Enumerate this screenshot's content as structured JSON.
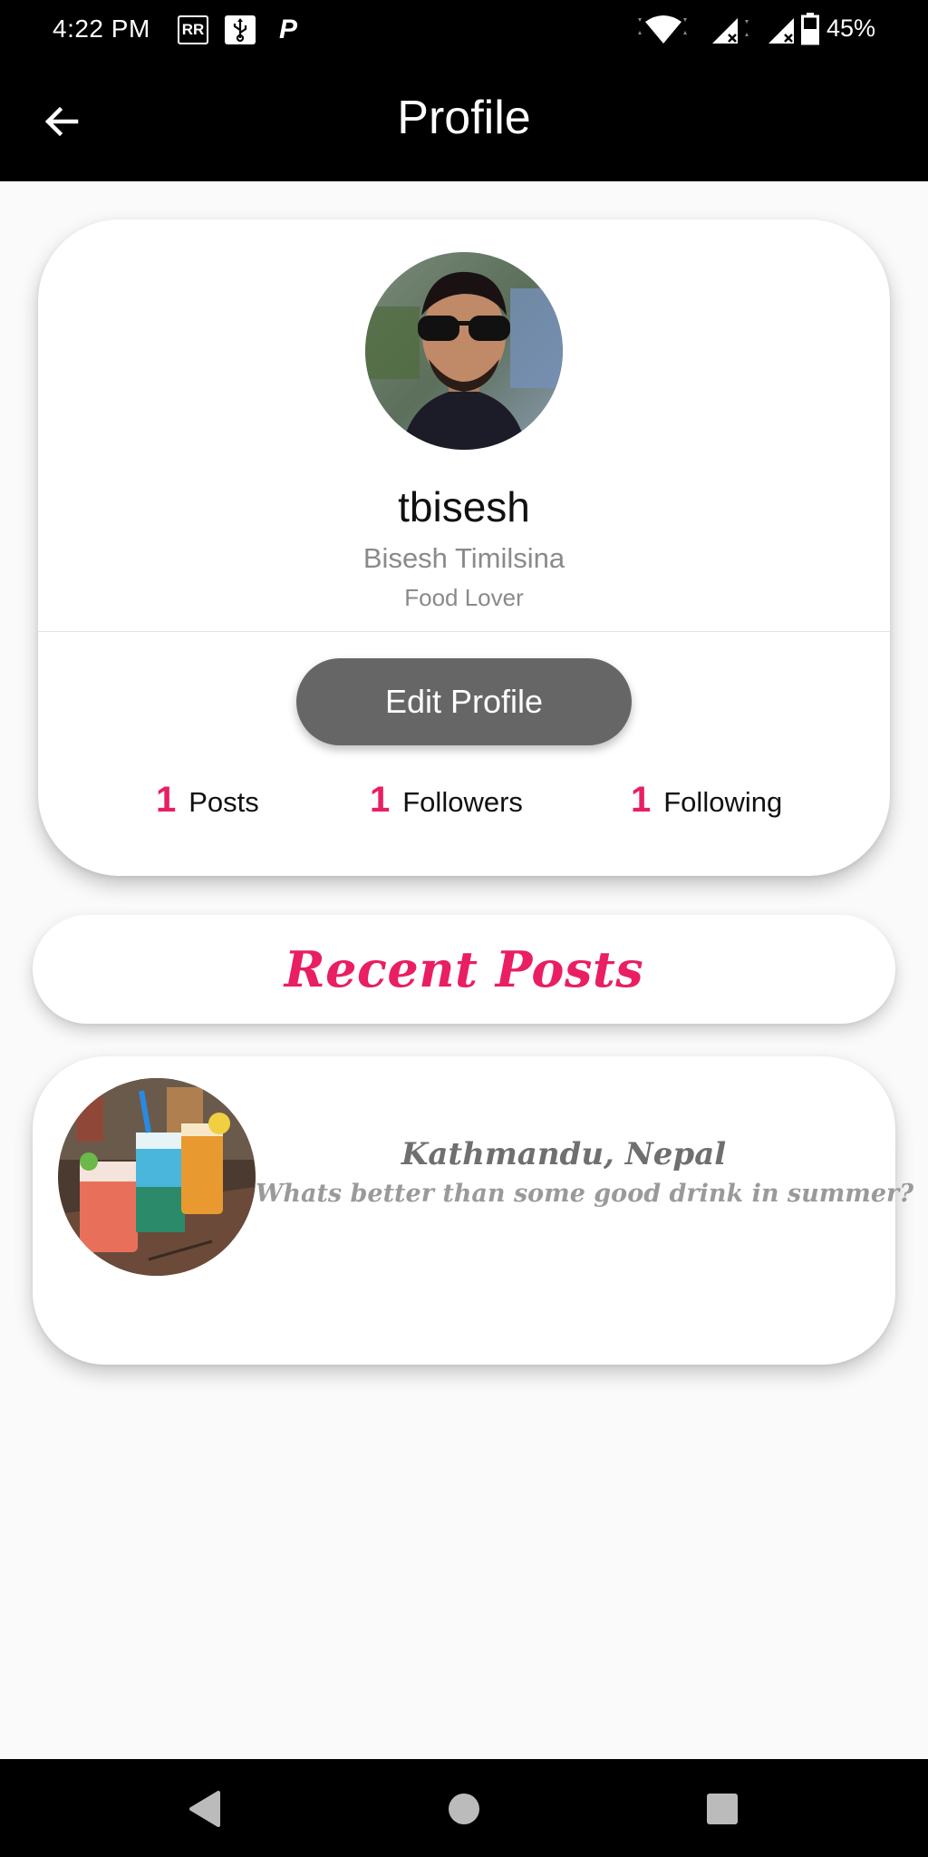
{
  "status_bar": {
    "time": "4:22 PM",
    "notification_icons": [
      "rr-icon",
      "usb-icon",
      "parking-icon"
    ],
    "battery": "45%",
    "system_icons": [
      "wifi-icon",
      "signal-icon",
      "signal-icon",
      "battery-icon"
    ]
  },
  "app_bar": {
    "title": "Profile",
    "back_icon": "arrow-left-icon"
  },
  "profile": {
    "username": "tbisesh",
    "full_name": "Bisesh Timilsina",
    "bio": "Food Lover",
    "edit_button_label": "Edit Profile",
    "stats": [
      {
        "count": "1",
        "label": "Posts"
      },
      {
        "count": "1",
        "label": "Followers"
      },
      {
        "count": "1",
        "label": "Following"
      }
    ]
  },
  "recent_posts": {
    "title": "Recent Posts",
    "items": [
      {
        "location": "Kathmandu, Nepal",
        "caption": "Whats better than some good drink in summer?"
      }
    ]
  },
  "nav_bar": {
    "buttons": [
      "back-triangle-icon",
      "home-circle-icon",
      "recents-square-icon"
    ]
  },
  "colors": {
    "accent": "#e91e63",
    "app_bar": "#000000",
    "button": "#666666",
    "background": "#fafafa"
  }
}
